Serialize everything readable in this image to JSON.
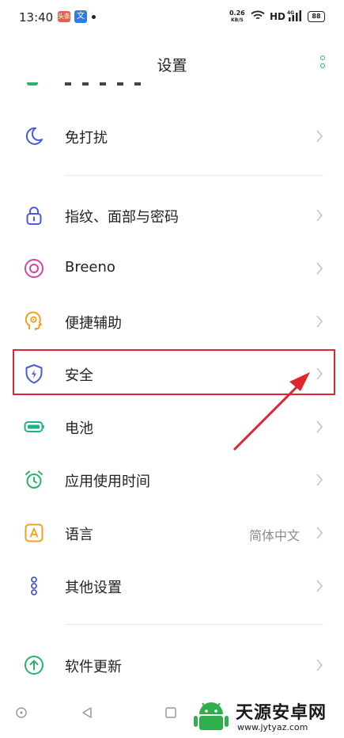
{
  "status_bar": {
    "time": "13:40",
    "app1": "头条",
    "app2": "文",
    "net_speed_value": "0.26",
    "net_speed_unit": "KB/S",
    "hd": "HD",
    "network": "4G",
    "battery": "88"
  },
  "header": {
    "title": "设置"
  },
  "rows": [
    {
      "label": "免打扰",
      "icon": "moon-icon",
      "value": ""
    },
    {
      "label": "指纹、面部与密码",
      "icon": "lock-icon",
      "value": ""
    },
    {
      "label": "Breeno",
      "icon": "breeno-icon",
      "value": ""
    },
    {
      "label": "便捷辅助",
      "icon": "accessibility-head-icon",
      "value": ""
    },
    {
      "label": "安全",
      "icon": "shield-icon",
      "value": ""
    },
    {
      "label": "电池",
      "icon": "battery-icon",
      "value": ""
    },
    {
      "label": "应用使用时间",
      "icon": "alarm-clock-icon",
      "value": ""
    },
    {
      "label": "语言",
      "icon": "language-icon",
      "value": "简体中文"
    },
    {
      "label": "其他设置",
      "icon": "dots-icon",
      "value": ""
    },
    {
      "label": "软件更新",
      "icon": "update-arrow-icon",
      "value": ""
    }
  ],
  "watermark": {
    "name": "天源安卓网",
    "url": "www.jytyaz.com"
  },
  "colors": {
    "accent": "#29b36b",
    "highlight": "#e0262d",
    "icon_blue": "#4b5bd6"
  }
}
